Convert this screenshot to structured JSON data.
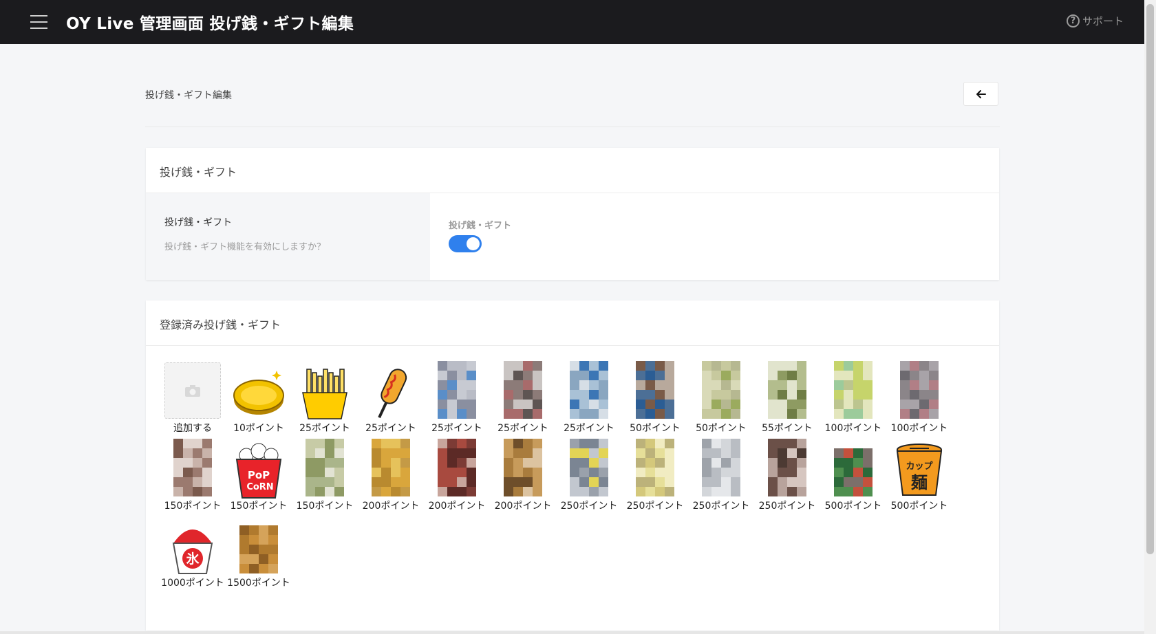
{
  "header": {
    "title": "OY Live 管理画面 投げ銭・ギフト編集",
    "support_label": "サポート"
  },
  "breadcrumb": "投げ銭・ギフト編集",
  "settings_card": {
    "title": "投げ銭・ギフト",
    "setting_label": "投げ銭・ギフト",
    "setting_description": "投げ銭・ギフト機能を有効にしますか？",
    "toggle_label": "投げ銭・ギフト",
    "toggle_on": true
  },
  "gifts_card": {
    "title": "登録済み投げ銭・ギフト",
    "add_label": "追加する",
    "gifts": [
      {
        "label": "10ポイント",
        "icon": "gold-coin-icon"
      },
      {
        "label": "25ポイント",
        "icon": "french-fries-icon"
      },
      {
        "label": "25ポイント",
        "icon": "corn-dog-icon"
      },
      {
        "label": "25ポイント",
        "icon": "pixelated-bottle-icon"
      },
      {
        "label": "25ポイント",
        "icon": "pixelated-bottle-icon"
      },
      {
        "label": "25ポイント",
        "icon": "pixelated-bottle-icon"
      },
      {
        "label": "50ポイント",
        "icon": "pixelated-bottle-icon"
      },
      {
        "label": "50ポイント",
        "icon": "pixelated-bottle-icon"
      },
      {
        "label": "55ポイント",
        "icon": "pixelated-bottle-icon"
      },
      {
        "label": "100ポイント",
        "icon": "pixelated-bottle-icon"
      },
      {
        "label": "100ポイント",
        "icon": "pixelated-can-icon"
      },
      {
        "label": "150ポイント",
        "icon": "pixelated-bottle-icon"
      },
      {
        "label": "150ポイント",
        "icon": "popcorn-icon"
      },
      {
        "label": "150ポイント",
        "icon": "pixelated-bottle-icon"
      },
      {
        "label": "200ポイント",
        "icon": "pixelated-can-icon"
      },
      {
        "label": "200ポイント",
        "icon": "pixelated-bottle-icon"
      },
      {
        "label": "200ポイント",
        "icon": "pixelated-bottle-icon"
      },
      {
        "label": "250ポイント",
        "icon": "pixelated-bottle-icon"
      },
      {
        "label": "250ポイント",
        "icon": "pixelated-bottle-icon"
      },
      {
        "label": "250ポイント",
        "icon": "pixelated-bottle-icon"
      },
      {
        "label": "250ポイント",
        "icon": "pixelated-bottle-icon"
      },
      {
        "label": "500ポイント",
        "icon": "pixelated-box-icon"
      },
      {
        "label": "500ポイント",
        "icon": "cup-noodle-icon"
      },
      {
        "label": "1000ポイント",
        "icon": "shaved-ice-icon"
      },
      {
        "label": "1500ポイント",
        "icon": "pixelated-box-icon"
      }
    ],
    "cup_noodle_text_top": "カップ",
    "cup_noodle_text_main": "麺",
    "shaved_ice_text": "氷",
    "popcorn_text_top": "PoP",
    "popcorn_text_bottom": "CoRN"
  },
  "colors": {
    "topbar": "#1b1b1e",
    "toggle_on": "#2f80ed",
    "background": "#f5f6f8"
  }
}
